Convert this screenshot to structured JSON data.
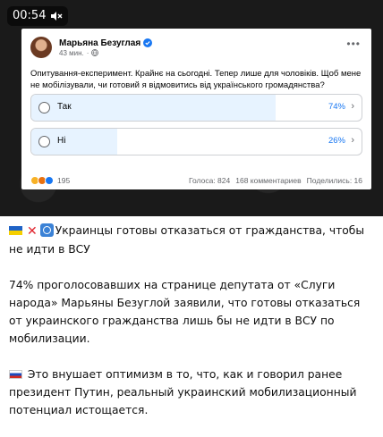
{
  "video": {
    "time": "00:54",
    "mute_icon": "muted-speaker-icon"
  },
  "post": {
    "author": "Марьяна Безуглая",
    "time": "43 мин.",
    "text": "Опитування-експеримент. Крайнє на сьогодні. Тепер лише для чоловіків. Щоб мене не мобілізували, чи готовий я відмовитись від українського громадянства?",
    "poll": [
      {
        "label": "Так",
        "percent": "74%",
        "fill": 0.74
      },
      {
        "label": "Ні",
        "percent": "26%",
        "fill": 0.26
      }
    ],
    "reactions_count": "195",
    "votes": "Голоса: 824",
    "comments": "168 комментариев",
    "shares": "Поделились: 16"
  },
  "message": {
    "headline": "Украинцы готовы отказаться от гражданства, чтобы не идти в ВСУ",
    "para1": "74% проголосовавших на странице депутата от «Слуги народа» Марьяны Безуглой заявили, что готовы отказаться от украинского гражданства лишь бы не идти в ВСУ по мобилизации.",
    "para2": "Это внушает оптимизм в то, что, как и говорил ранее президент Путин, реальный украинский мобилизационный потенциал истощается."
  },
  "colors": {
    "poll_fill": "#e7f3ff",
    "percent": "#1877f2",
    "video_bg": "#1a1a1a"
  }
}
